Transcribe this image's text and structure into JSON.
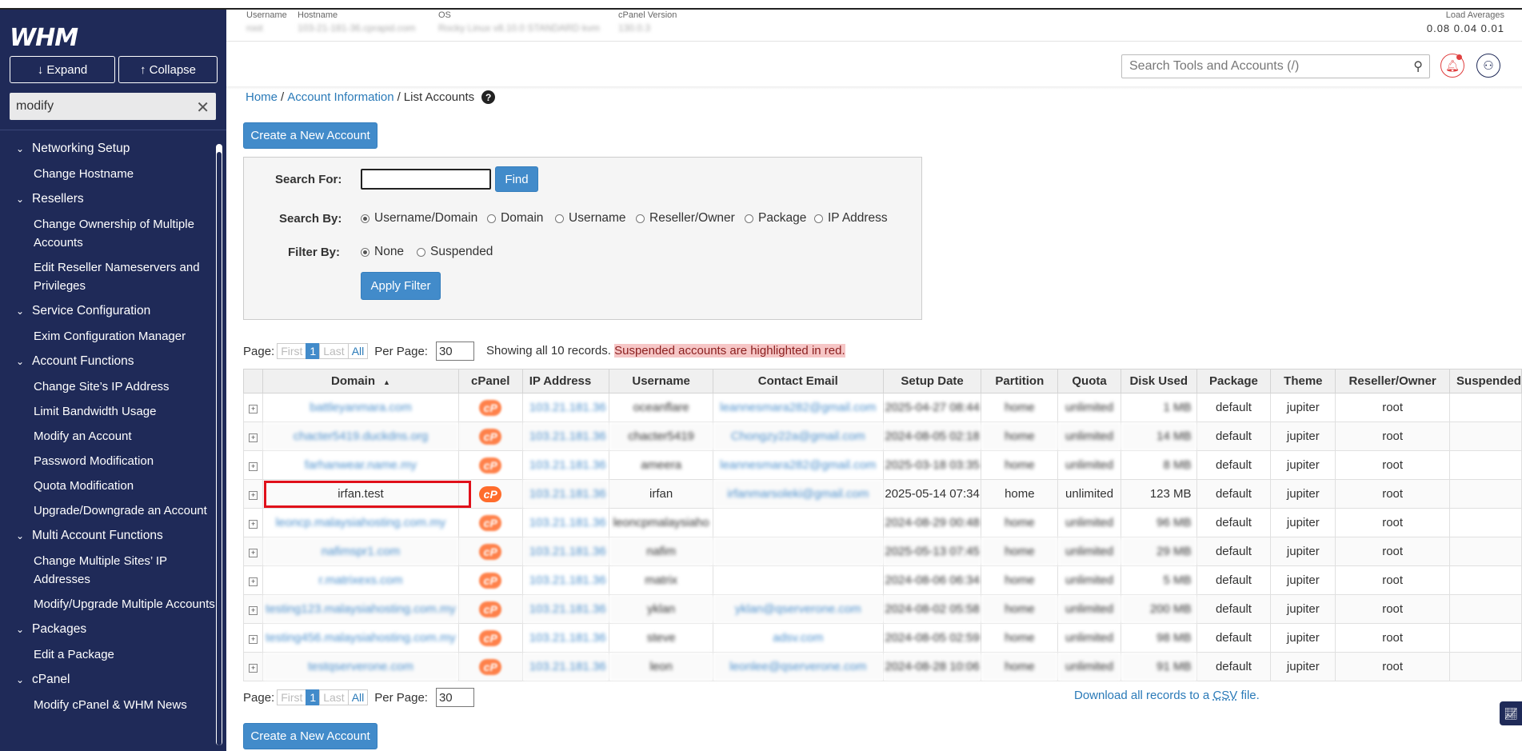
{
  "sidebar": {
    "logo": "WHM",
    "expand_label": "↓ Expand",
    "collapse_label": "↑ Collapse",
    "filter_value": "modify",
    "groups": [
      {
        "label": "Networking Setup",
        "items": [
          "Change Hostname"
        ]
      },
      {
        "label": "Resellers",
        "items": [
          "Change Ownership of Multiple Accounts",
          "Edit Reseller Nameservers and Privileges"
        ]
      },
      {
        "label": "Service Configuration",
        "items": [
          "Exim Configuration Manager"
        ]
      },
      {
        "label": "Account Functions",
        "items": [
          "Change Site’s IP Address",
          "Limit Bandwidth Usage",
          "Modify an Account",
          "Password Modification",
          "Quota Modification",
          "Upgrade/Downgrade an Account"
        ]
      },
      {
        "label": "Multi Account Functions",
        "items": [
          "Change Multiple Sites’ IP Addresses",
          "Modify/Upgrade Multiple Accounts"
        ]
      },
      {
        "label": "Packages",
        "items": [
          "Edit a Package"
        ]
      },
      {
        "label": "cPanel",
        "items": [
          "Modify cPanel & WHM News"
        ]
      }
    ]
  },
  "topinfo": {
    "username_label": "Username",
    "username_value": "root",
    "hostname_label": "Hostname",
    "hostname_value": "103-21-181-36.cprapid.com",
    "os_label": "OS",
    "os_value": "Rocky Linux v8.10.0 STANDARD kvm",
    "cpanel_label": "cPanel Version",
    "cpanel_value": "130.0.3",
    "load_label": "Load Averages",
    "load_values": "0.08  0.04  0.01"
  },
  "search": {
    "placeholder": "Search Tools and Accounts (/)"
  },
  "breadcrumb": {
    "home": "Home",
    "sep": "/",
    "account_info": "Account Information",
    "current": "List Accounts",
    "help": "?"
  },
  "buttons": {
    "create_account": "Create a New Account",
    "find": "Find",
    "apply_filter": "Apply Filter"
  },
  "panel": {
    "search_for_label": "Search For:",
    "search_by_label": "Search By:",
    "filter_by_label": "Filter By:",
    "search_by_options": [
      "Username/Domain",
      "Domain",
      "Username",
      "Reseller/Owner",
      "Package",
      "IP Address"
    ],
    "filter_by_options": [
      "None",
      "Suspended"
    ]
  },
  "pager": {
    "page_label": "Page:",
    "first": "First",
    "current": "1",
    "last": "Last",
    "all": "All",
    "per_page_label": "Per Page:",
    "per_page_value": "30"
  },
  "showing": {
    "text": "Showing all 10 records.",
    "highlight": "Suspended accounts are highlighted in red."
  },
  "table": {
    "headers": [
      "Domain",
      "cPanel",
      "IP Address",
      "Username",
      "Contact Email",
      "Setup Date",
      "Partition",
      "Quota",
      "Disk Used",
      "Package",
      "Theme",
      "Reseller/Owner",
      "Suspended"
    ],
    "sort_glyph": "▲",
    "rows": [
      {
        "domain": "battleyanmara.com",
        "ip": "103.21.181.36",
        "user": "oceanflare",
        "email": "leannesmara282@gmail.com",
        "date": "2025-04-27 08:44",
        "partition": "home",
        "quota": "unlimited",
        "disk": "1 MB",
        "package": "default",
        "theme": "jupiter",
        "owner": "root",
        "blur": true
      },
      {
        "domain": "chacter5419.duckdns.org",
        "ip": "103.21.181.36",
        "user": "chacter5419",
        "email": "Chongzy22a@gmail.com",
        "date": "2024-08-05 02:18",
        "partition": "home",
        "quota": "unlimited",
        "disk": "14 MB",
        "package": "default",
        "theme": "jupiter",
        "owner": "root",
        "blur": true
      },
      {
        "domain": "farhanwear.name.my",
        "ip": "103.21.181.36",
        "user": "ameera",
        "email": "leannesmara282@gmail.com",
        "date": "2025-03-18 03:35",
        "partition": "home",
        "quota": "unlimited",
        "disk": "8 MB",
        "package": "default",
        "theme": "jupiter",
        "owner": "root",
        "blur": true
      },
      {
        "domain": "irfan.test",
        "ip": "103.21.181.36",
        "user": "irfan",
        "email": "irfanmarsoleki@gmail.com",
        "date": "2025-05-14 07:34",
        "partition": "home",
        "quota": "unlimited",
        "disk": "123 MB",
        "package": "default",
        "theme": "jupiter",
        "owner": "root",
        "blur": false
      },
      {
        "domain": "leoncp.malaysiahosting.com.my",
        "ip": "103.21.181.36",
        "user": "leoncpmalaysiaho",
        "email": "",
        "date": "2024-08-29 00:48",
        "partition": "home",
        "quota": "unlimited",
        "disk": "96 MB",
        "package": "default",
        "theme": "jupiter",
        "owner": "root",
        "blur": true
      },
      {
        "domain": "nafimspr1.com",
        "ip": "103.21.181.36",
        "user": "nafim",
        "email": "",
        "date": "2025-05-13 07:45",
        "partition": "home",
        "quota": "unlimited",
        "disk": "29 MB",
        "package": "default",
        "theme": "jupiter",
        "owner": "root",
        "blur": true
      },
      {
        "domain": "r.matrixexs.com",
        "ip": "103.21.181.36",
        "user": "matrix",
        "email": "",
        "date": "2024-08-06 06:34",
        "partition": "home",
        "quota": "unlimited",
        "disk": "5 MB",
        "package": "default",
        "theme": "jupiter",
        "owner": "root",
        "blur": true
      },
      {
        "domain": "testing123.malaysiahosting.com.my",
        "ip": "103.21.181.36",
        "user": "yklan",
        "email": "yklan@qserverone.com",
        "date": "2024-08-02 05:58",
        "partition": "home",
        "quota": "unlimited",
        "disk": "200 MB",
        "package": "default",
        "theme": "jupiter",
        "owner": "root",
        "blur": true
      },
      {
        "domain": "testing456.malaysiahosting.com.my",
        "ip": "103.21.181.36",
        "user": "steve",
        "email": "adsv.com",
        "date": "2024-08-05 02:59",
        "partition": "home",
        "quota": "unlimited",
        "disk": "98 MB",
        "package": "default",
        "theme": "jupiter",
        "owner": "root",
        "blur": true
      },
      {
        "domain": "testqserverone.com",
        "ip": "103.21.181.36",
        "user": "leon",
        "email": "leonlee@qserverone.com",
        "date": "2024-08-28 10:06",
        "partition": "home",
        "quota": "unlimited",
        "disk": "91 MB",
        "package": "default",
        "theme": "jupiter",
        "owner": "root",
        "blur": true
      }
    ]
  },
  "download": {
    "prefix": "Download all records to a",
    "abbr": "CSV",
    "suffix": "file."
  },
  "colors": {
    "sidebar": "#1f2a58",
    "primary": "#428bca",
    "link": "#2a7ab8",
    "highlight_red": "#e0101a",
    "cpanel_orange": "#ff6c2c"
  }
}
